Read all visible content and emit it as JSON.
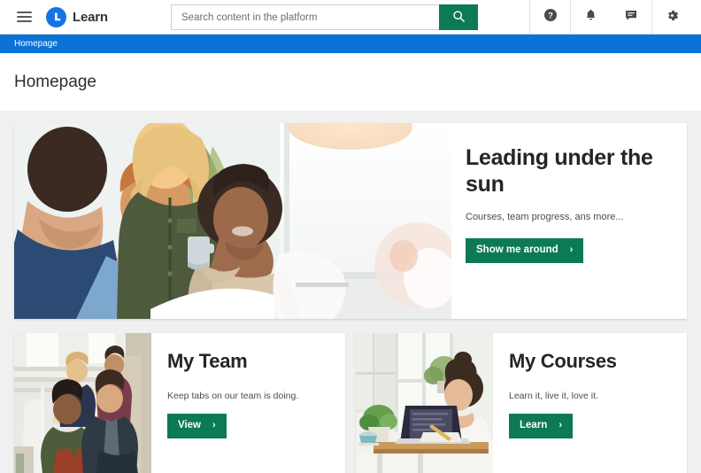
{
  "header": {
    "menu_icon": "hamburger-menu-icon",
    "brand_name": "Learn",
    "brand_logo_icon": "learn-logo-icon",
    "search": {
      "placeholder": "Search content in the platform",
      "value": "",
      "button_icon": "search-icon",
      "button_color": "#0c7a55"
    },
    "actions": [
      {
        "name": "help-icon",
        "glyph": "?"
      },
      {
        "name": "notifications-bell-icon",
        "glyph": "bell"
      },
      {
        "name": "messages-chat-icon",
        "glyph": "chat"
      },
      {
        "name": "settings-gear-icon",
        "glyph": "gear"
      }
    ]
  },
  "breadcrumb": {
    "items": [
      {
        "label": "Homepage"
      }
    ],
    "background_color": "#0a72d8"
  },
  "page": {
    "title": "Homepage",
    "background_color": "#f0f0f0"
  },
  "hero": {
    "image_alt": "colleagues-smiling-around-laptop-photo",
    "heading": "Leading under the sun",
    "subtitle": "Courses, team progress, ans more...",
    "button_label": "Show me around",
    "button_chevron": "›",
    "button_color": "#0c7a55"
  },
  "cards": [
    {
      "image_alt": "team-walking-down-stairs-photo",
      "heading": "My Team",
      "subtitle": "Keep tabs on our team is doing.",
      "button_label": "View",
      "button_chevron": "›",
      "button_color": "#0c7a55"
    },
    {
      "image_alt": "woman-studying-at-desk-with-laptop-photo",
      "heading": "My Courses",
      "subtitle": "Learn it, live it, love it.",
      "button_label": "Learn",
      "button_chevron": "›",
      "button_color": "#0c7a55"
    }
  ]
}
